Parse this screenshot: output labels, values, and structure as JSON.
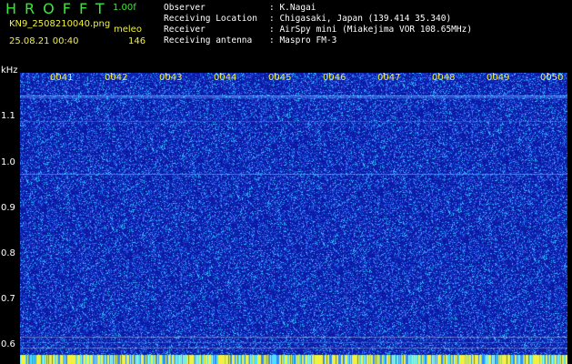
{
  "header": {
    "app_title": "HROFFT",
    "version": "1.00f",
    "filename": "KN9_2508210040.png",
    "mode": "meleo",
    "datetime": "25.08.21 00:40",
    "count": "146"
  },
  "meta": [
    {
      "key": "Observer",
      "value": ": K.Nagai"
    },
    {
      "key": "Receiving Location",
      "value": ": Chigasaki, Japan (139.414 35.340)"
    },
    {
      "key": "Receiver",
      "value": ": AirSpy mini (Miakejima VOR 108.65MHz)"
    },
    {
      "key": "Receiving antenna",
      "value": ": Maspro FM-3"
    }
  ],
  "spectrogram": {
    "y_unit": "kHz",
    "y_ticks": [
      "1.1",
      "1.0",
      "0.9",
      "0.8",
      "0.7",
      "0.6"
    ],
    "x_ticks": [
      "0041",
      "0042",
      "0043",
      "0044",
      "0045",
      "0046",
      "0047",
      "0048",
      "0049",
      "0050"
    ],
    "colors": {
      "background": "#0b17a0",
      "speckle_hot": "#35c8ff",
      "speckle_warm": "#2e7bff",
      "carrier": "#4de0ff",
      "bottom_bar": "#f5f03c"
    }
  }
}
